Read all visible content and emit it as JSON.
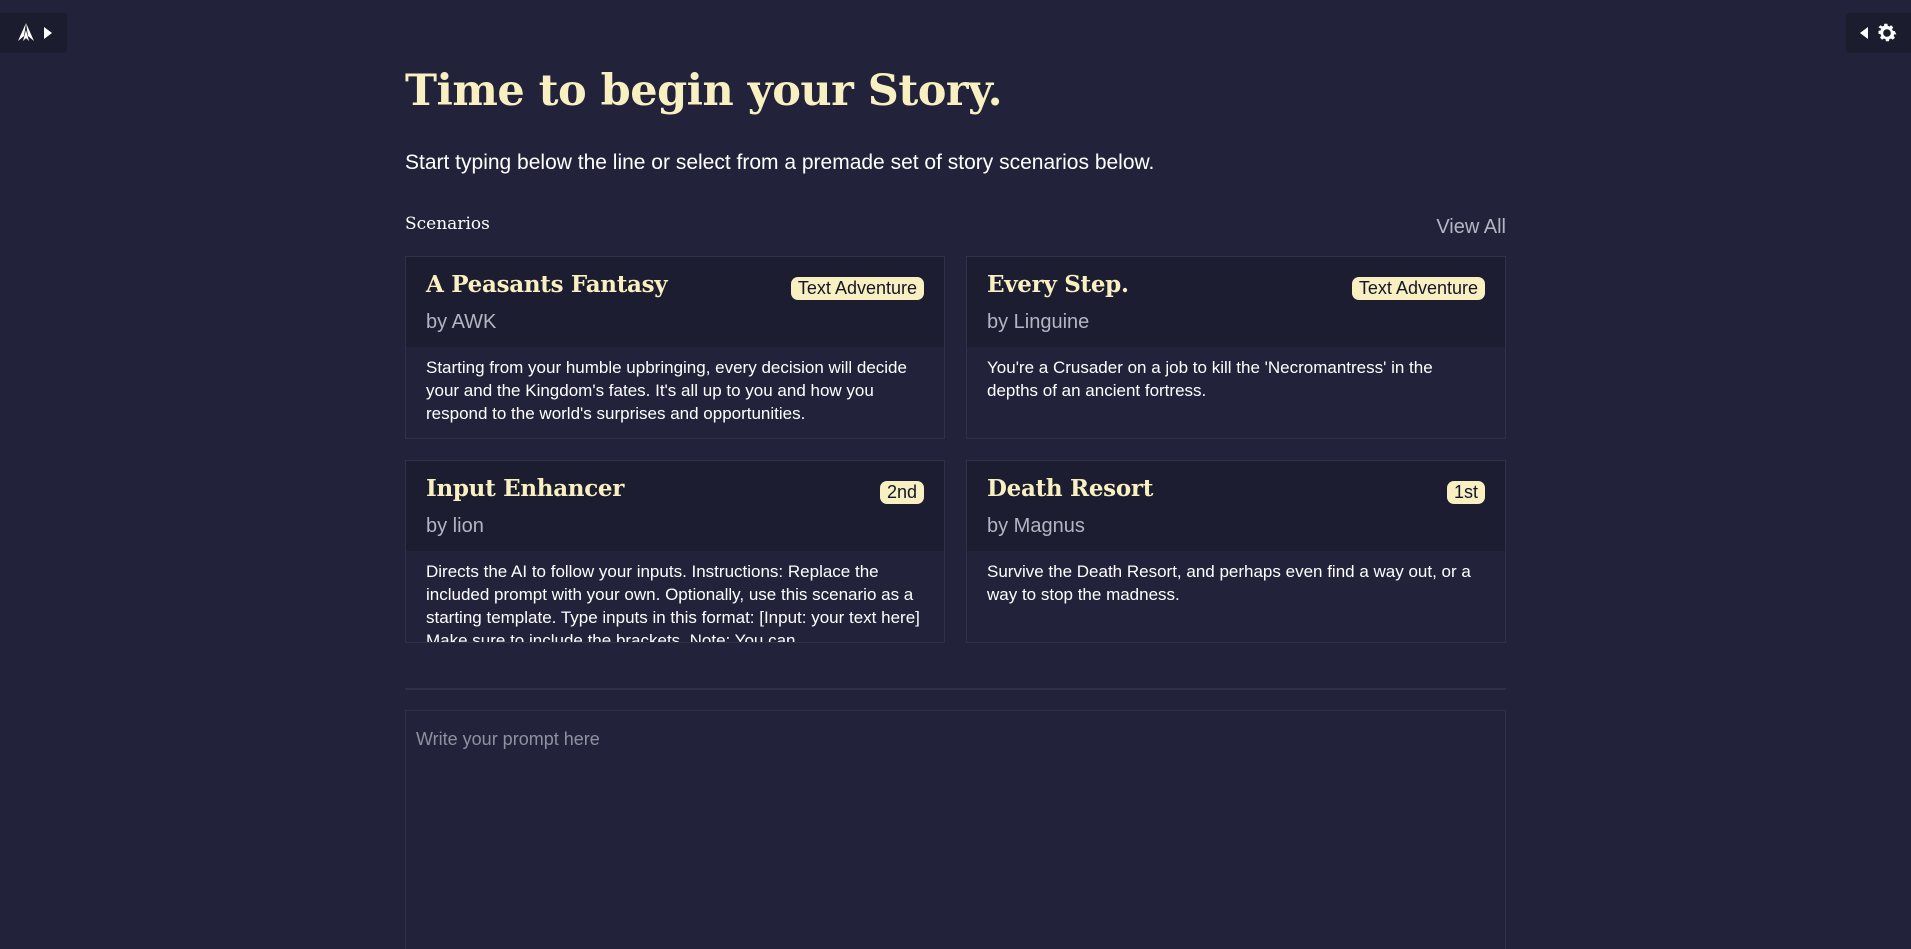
{
  "header": {
    "title": "Time to begin your Story.",
    "subtitle": "Start typing below the line or select from a premade set of story scenarios below."
  },
  "scenarios": {
    "label": "Scenarios",
    "view_all": "View All",
    "items": [
      {
        "title": "A Peasants Fantasy",
        "author": "by AWK",
        "badge": "Text Adventure",
        "description": "Starting from your humble upbringing, every decision will decide your and the Kingdom's fates. It's all up to you and how you respond to the world's surprises and opportunities."
      },
      {
        "title": "Every Step.",
        "author": "by Linguine",
        "badge": "Text Adventure",
        "description": "You're a Crusader on a job to kill the 'Necromantress' in the depths of an ancient fortress."
      },
      {
        "title": "Input Enhancer",
        "author": "by lion",
        "badge": "2nd",
        "description": "Directs the AI to follow your inputs. Instructions: Replace the included prompt with your own. Optionally, use this scenario as a starting template. Type inputs in this format: [Input: your text here] Make sure to include the brackets. Note: You can…"
      },
      {
        "title": "Death Resort",
        "author": "by Magnus",
        "badge": "1st",
        "description": "Survive the Death Resort, and perhaps even find a way out, or a way to stop the madness."
      }
    ]
  },
  "prompt": {
    "placeholder": "Write your prompt here",
    "value": ""
  },
  "icons": {
    "left_toggle": "logo-icon",
    "left_arrow": "caret-right-icon",
    "right_arrow": "caret-left-icon",
    "settings": "gear-icon"
  },
  "colors": {
    "background": "#22233a",
    "card_header": "#1c1d30",
    "accent": "#f8f0c0",
    "border": "#303149",
    "muted_text": "#b4b5c3"
  }
}
